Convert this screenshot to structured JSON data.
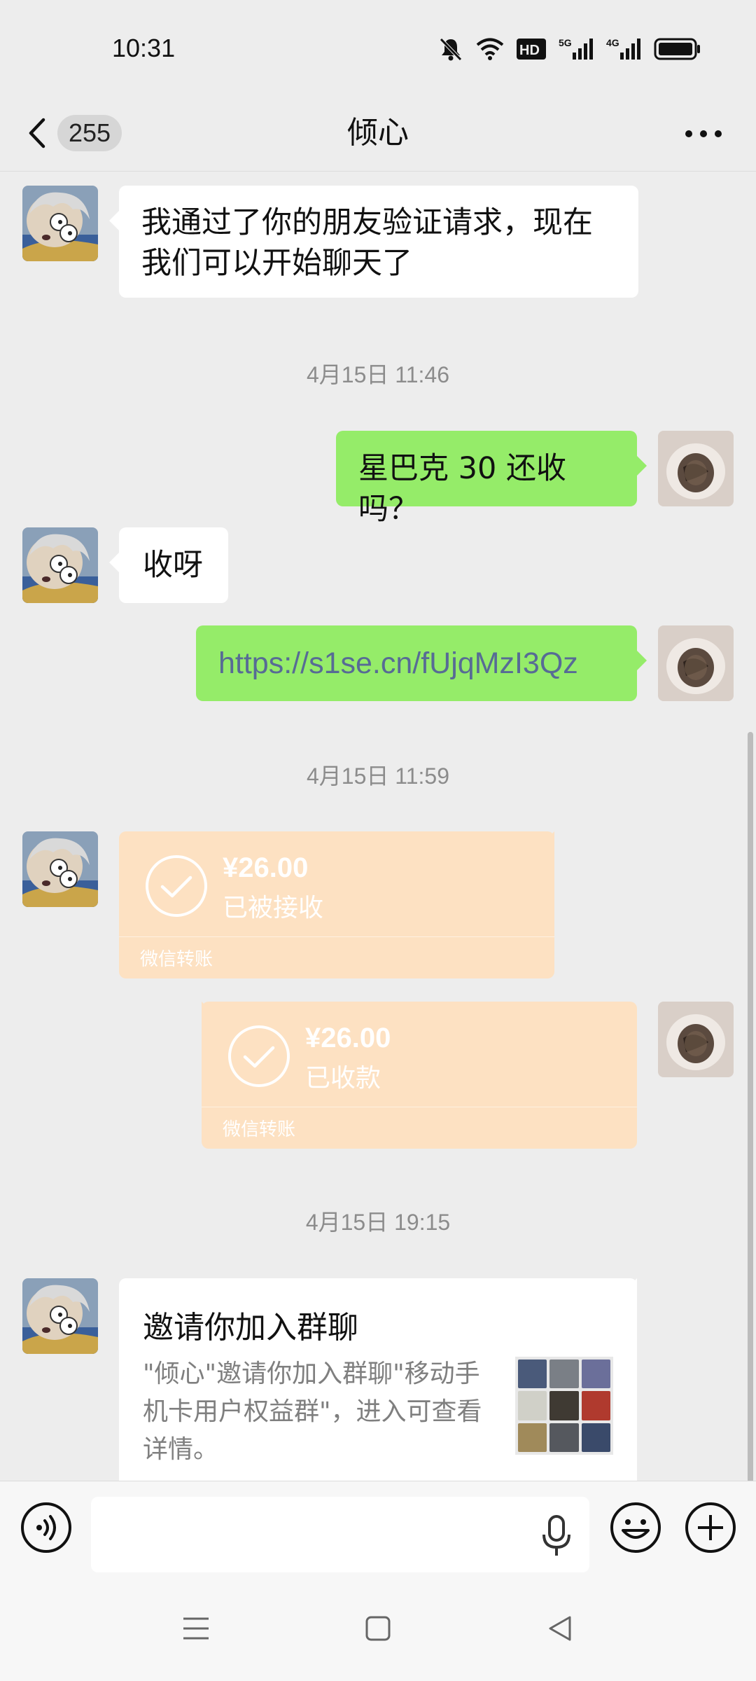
{
  "status_bar": {
    "time": "10:31",
    "network_1": "5G",
    "network_2": "4G"
  },
  "header": {
    "back_icon": "chevron-left-icon",
    "unread_count": "255",
    "title": "倾心",
    "more_icon": "more-icon"
  },
  "messages": [
    {
      "type": "text",
      "side": "left",
      "text_line1": "我通过了你的朋友验证请求，现在",
      "text_line2": "我们可以开始聊天了"
    },
    {
      "type": "timestamp",
      "text": "4月15日 11:46"
    },
    {
      "type": "text",
      "side": "right",
      "text": "星巴克 30 还收吗？"
    },
    {
      "type": "text",
      "side": "left",
      "text": "收呀"
    },
    {
      "type": "link",
      "side": "right",
      "text": "https://s1se.cn/fUjqMzI3Qz"
    },
    {
      "type": "timestamp",
      "text": "4月15日 11:59"
    },
    {
      "type": "transfer",
      "side": "left",
      "amount": "¥26.00",
      "status": "已被接收",
      "label": "微信转账"
    },
    {
      "type": "transfer",
      "side": "right",
      "amount": "¥26.00",
      "status": "已收款",
      "label": "微信转账"
    },
    {
      "type": "timestamp",
      "text": "4月15日 19:15"
    },
    {
      "type": "group_invite",
      "side": "left",
      "title": "邀请你加入群聊",
      "desc_line1": "\"倾心\"邀请你加入群聊\"移动手",
      "desc_line2": "机卡用户权益群\"，进入可查看",
      "desc_line3": "详情。"
    }
  ],
  "input_bar": {
    "placeholder": "",
    "voice_icon": "voice-icon",
    "mic_icon": "mic-icon",
    "emoji_icon": "emoji-icon",
    "plus_icon": "plus-icon"
  },
  "colors": {
    "background": "#ededed",
    "green_bubble": "#95ec69",
    "transfer_card": "#fde1c2",
    "link": "#576b95",
    "timestamp": "#8c8c8c"
  }
}
